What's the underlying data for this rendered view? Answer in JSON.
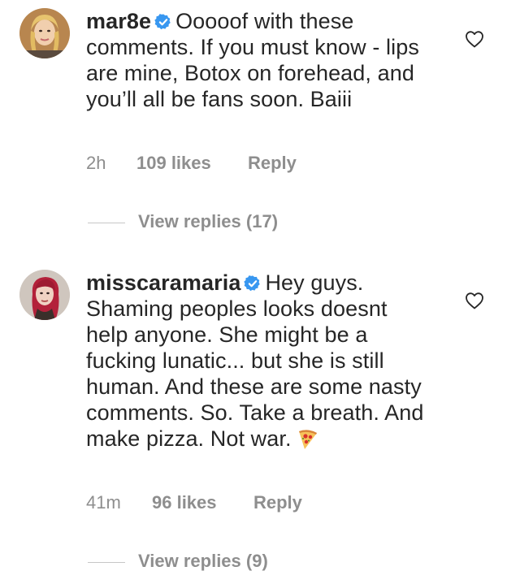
{
  "comments": [
    {
      "username": "mar8e",
      "text": "Ooooof with these comments. If you must know - lips are mine, Botox on forehead, and you’ll all be fans soon. Baiii",
      "time": "2h",
      "likes": "109 likes",
      "reply": "Reply",
      "view_replies": "View replies (17)",
      "verified": true
    },
    {
      "username": "misscaramaria",
      "text": "Hey guys. Shaming peoples looks doesnt help anyone. She might be a fucking lunatic... but she is still human. And these are some nasty comments. So. Take a breath. And make pizza. Not war.",
      "time": "41m",
      "likes": "96 likes",
      "reply": "Reply",
      "view_replies": "View replies (9)",
      "verified": true
    }
  ],
  "colors": {
    "text": "#262626",
    "muted": "#8e8e8e",
    "verified_blue": "#3897f0"
  },
  "icons": [
    "verified-badge-icon",
    "heart-outline-icon",
    "pizza-emoji-icon"
  ]
}
